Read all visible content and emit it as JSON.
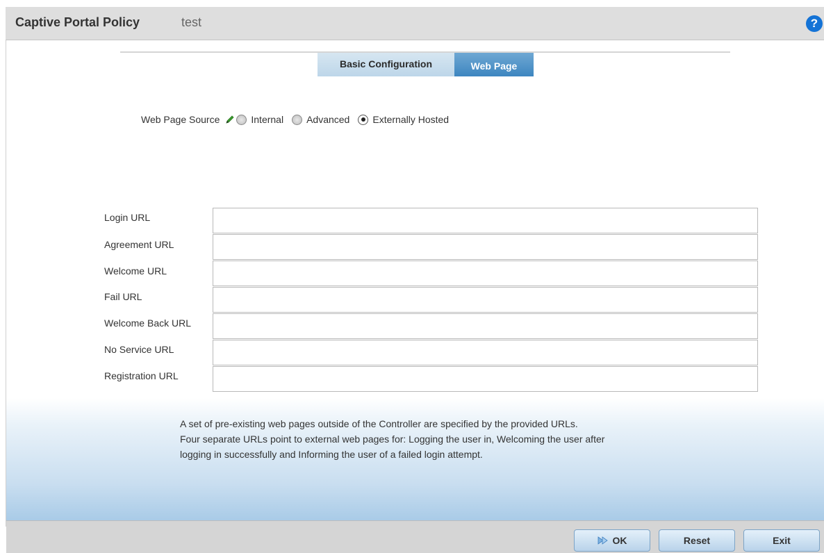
{
  "title": {
    "main": "Captive Portal Policy",
    "name": "test",
    "help_icon": "question-circle-icon",
    "help_glyph": "?"
  },
  "tabs": [
    {
      "label": "Basic Configuration",
      "active": false
    },
    {
      "label": "Web Page",
      "active": true
    }
  ],
  "web_page_source": {
    "label": "Web Page Source",
    "options": [
      "Internal",
      "Advanced",
      "Externally Hosted"
    ],
    "selected": "Externally Hosted"
  },
  "urls": [
    {
      "label": "Login URL",
      "value": ""
    },
    {
      "label": "Agreement URL",
      "value": ""
    },
    {
      "label": "Welcome URL",
      "value": ""
    },
    {
      "label": "Fail URL",
      "value": ""
    },
    {
      "label": "Welcome Back URL",
      "value": ""
    },
    {
      "label": "No Service URL",
      "value": ""
    },
    {
      "label": "Registration URL",
      "value": ""
    }
  ],
  "info": {
    "lines": [
      "A set of pre-existing web pages outside of the Controller are specified by the provided URLs.",
      "Four separate URLs point to external web pages for: Logging the user in, Welcoming the user after",
      "logging in successfully and Informing the user of a failed login attempt."
    ]
  },
  "footer": {
    "ok_label": "OK",
    "reset_label": "Reset",
    "exit_label": "Exit"
  },
  "colors": {
    "title_bar": "#dedede",
    "tab_active": "#3d86c0",
    "tab_inactive": "#bdd6e9",
    "help_icon": "#1473d6",
    "info_gradient_end": "#a9cbe7"
  }
}
